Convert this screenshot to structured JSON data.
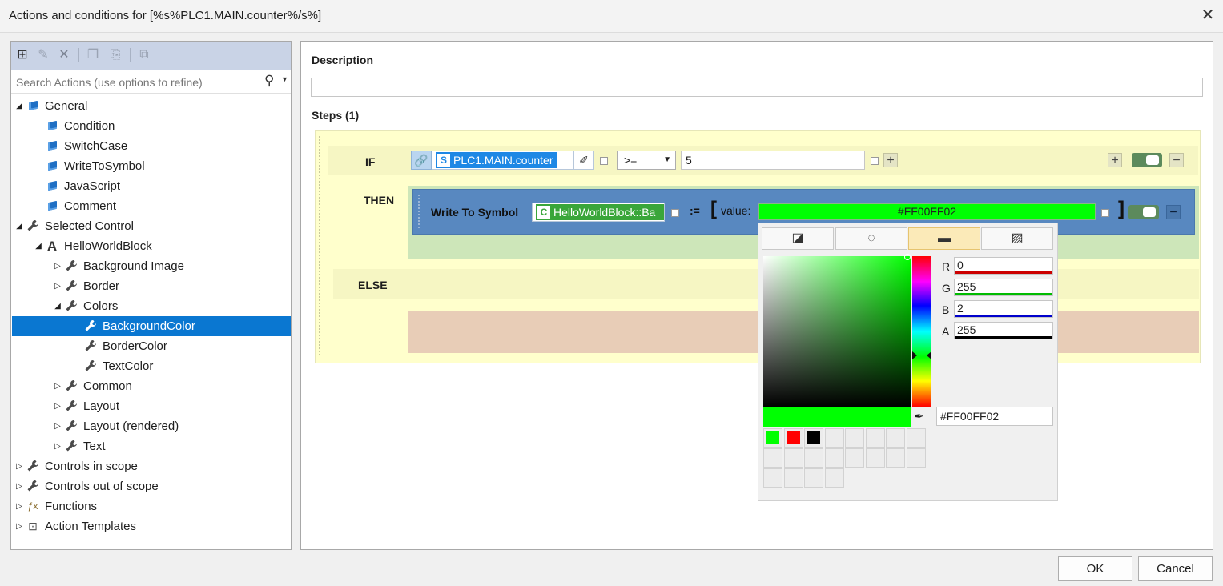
{
  "window": {
    "title": "Actions and conditions for [%s%PLC1.MAIN.counter%/s%]",
    "close_icon": "close-icon"
  },
  "search": {
    "placeholder": "Search Actions (use options to refine)"
  },
  "toolbar": {
    "icons": [
      "add-action-icon",
      "edit-action-icon",
      "delete-icon",
      "copy-icon",
      "paste-icon",
      "template-icon"
    ]
  },
  "tree": [
    {
      "label": "General",
      "level": 0,
      "expander": "open",
      "icon": "cube-icon"
    },
    {
      "label": "Condition",
      "level": 1,
      "expander": "none",
      "icon": "cube-icon"
    },
    {
      "label": "SwitchCase",
      "level": 1,
      "expander": "none",
      "icon": "cube-icon"
    },
    {
      "label": "WriteToSymbol",
      "level": 1,
      "expander": "none",
      "icon": "cube-icon"
    },
    {
      "label": "JavaScript",
      "level": 1,
      "expander": "none",
      "icon": "cube-icon"
    },
    {
      "label": "Comment",
      "level": 1,
      "expander": "none",
      "icon": "cube-icon"
    },
    {
      "label": "Selected Control",
      "level": 0,
      "expander": "open",
      "icon": "wrench-icon"
    },
    {
      "label": "HelloWorldBlock",
      "level": 1,
      "expander": "open",
      "icon": "text-control-icon"
    },
    {
      "label": "Background Image",
      "level": 2,
      "expander": "closed",
      "icon": "wrench-icon"
    },
    {
      "label": "Border",
      "level": 2,
      "expander": "closed",
      "icon": "wrench-icon"
    },
    {
      "label": "Colors",
      "level": 2,
      "expander": "open",
      "icon": "wrench-icon"
    },
    {
      "label": "BackgroundColor",
      "level": 3,
      "expander": "none",
      "icon": "wrench-icon",
      "selected": true
    },
    {
      "label": "BorderColor",
      "level": 3,
      "expander": "none",
      "icon": "wrench-icon"
    },
    {
      "label": "TextColor",
      "level": 3,
      "expander": "none",
      "icon": "wrench-icon"
    },
    {
      "label": "Common",
      "level": 2,
      "expander": "closed",
      "icon": "wrench-icon"
    },
    {
      "label": "Layout",
      "level": 2,
      "expander": "closed",
      "icon": "wrench-icon"
    },
    {
      "label": "Layout (rendered)",
      "level": 2,
      "expander": "closed",
      "icon": "wrench-icon"
    },
    {
      "label": "Text",
      "level": 2,
      "expander": "closed",
      "icon": "wrench-icon"
    },
    {
      "label": "Controls in scope",
      "level": 0,
      "expander": "closed",
      "icon": "wrench-icon"
    },
    {
      "label": "Controls out of scope",
      "level": 0,
      "expander": "closed",
      "icon": "wrench-icon"
    },
    {
      "label": "Functions",
      "level": 0,
      "expander": "closed",
      "icon": "functions-icon"
    },
    {
      "label": "Action Templates",
      "level": 0,
      "expander": "closed",
      "icon": "template-icon"
    }
  ],
  "description": {
    "label": "Description",
    "value": ""
  },
  "steps": {
    "label": "Steps (1)",
    "if_label": "IF",
    "symbol_badge": "S",
    "symbol": "PLC1.MAIN.counter",
    "operator": ">=",
    "compare_value": "5",
    "then_label": "THEN",
    "action_label": "Write To Symbol",
    "target_badge": "C",
    "target": "HelloWorldBlock::Ba",
    "assign": ":=",
    "bracket_open": "[",
    "bracket_close": "]",
    "value_label": "value:",
    "value": "#FF00FF02",
    "else_label": "ELSE"
  },
  "picker": {
    "tabs": [
      "no-color-icon",
      "radial-gradient-icon",
      "solid-color-icon",
      "linear-gradient-icon"
    ],
    "active_tab": 2,
    "channels": [
      {
        "label": "R",
        "value": "0",
        "color": "#cc0000"
      },
      {
        "label": "G",
        "value": "255",
        "color": "#00bb00"
      },
      {
        "label": "B",
        "value": "2",
        "color": "#0000cc"
      },
      {
        "label": "A",
        "value": "255",
        "color": "#000000"
      }
    ],
    "hex": "#FF00FF02",
    "current_color": "#00ff02",
    "recent_colors": [
      "#00ff00",
      "#ff0000",
      "#000000"
    ]
  },
  "buttons": {
    "ok": "OK",
    "cancel": "Cancel"
  }
}
